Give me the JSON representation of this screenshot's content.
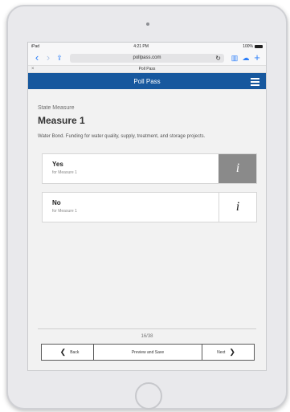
{
  "status": {
    "carrier": "iPad",
    "time": "4:21 PM",
    "battery": "100%"
  },
  "browser": {
    "url": "pollpass.com",
    "tab_title": "Poll Pass"
  },
  "app": {
    "title": "Poll Pass"
  },
  "measure": {
    "kicker": "State Measure",
    "title": "Measure 1",
    "description": "Water Bond. Funding for water quality, supply, treatment, and storage projects."
  },
  "options": [
    {
      "label": "Yes",
      "sub": "for Measure 1",
      "info": "i",
      "selected": true
    },
    {
      "label": "No",
      "sub": "for Measure 1",
      "info": "i",
      "selected": false
    }
  ],
  "pagination": {
    "counter": "16/38",
    "back": "Back",
    "preview": "Preview and Save",
    "next": "Next"
  },
  "colors": {
    "accent": "#17589e",
    "selected_info": "#8a8a8a",
    "background": "#f2f2f2"
  }
}
